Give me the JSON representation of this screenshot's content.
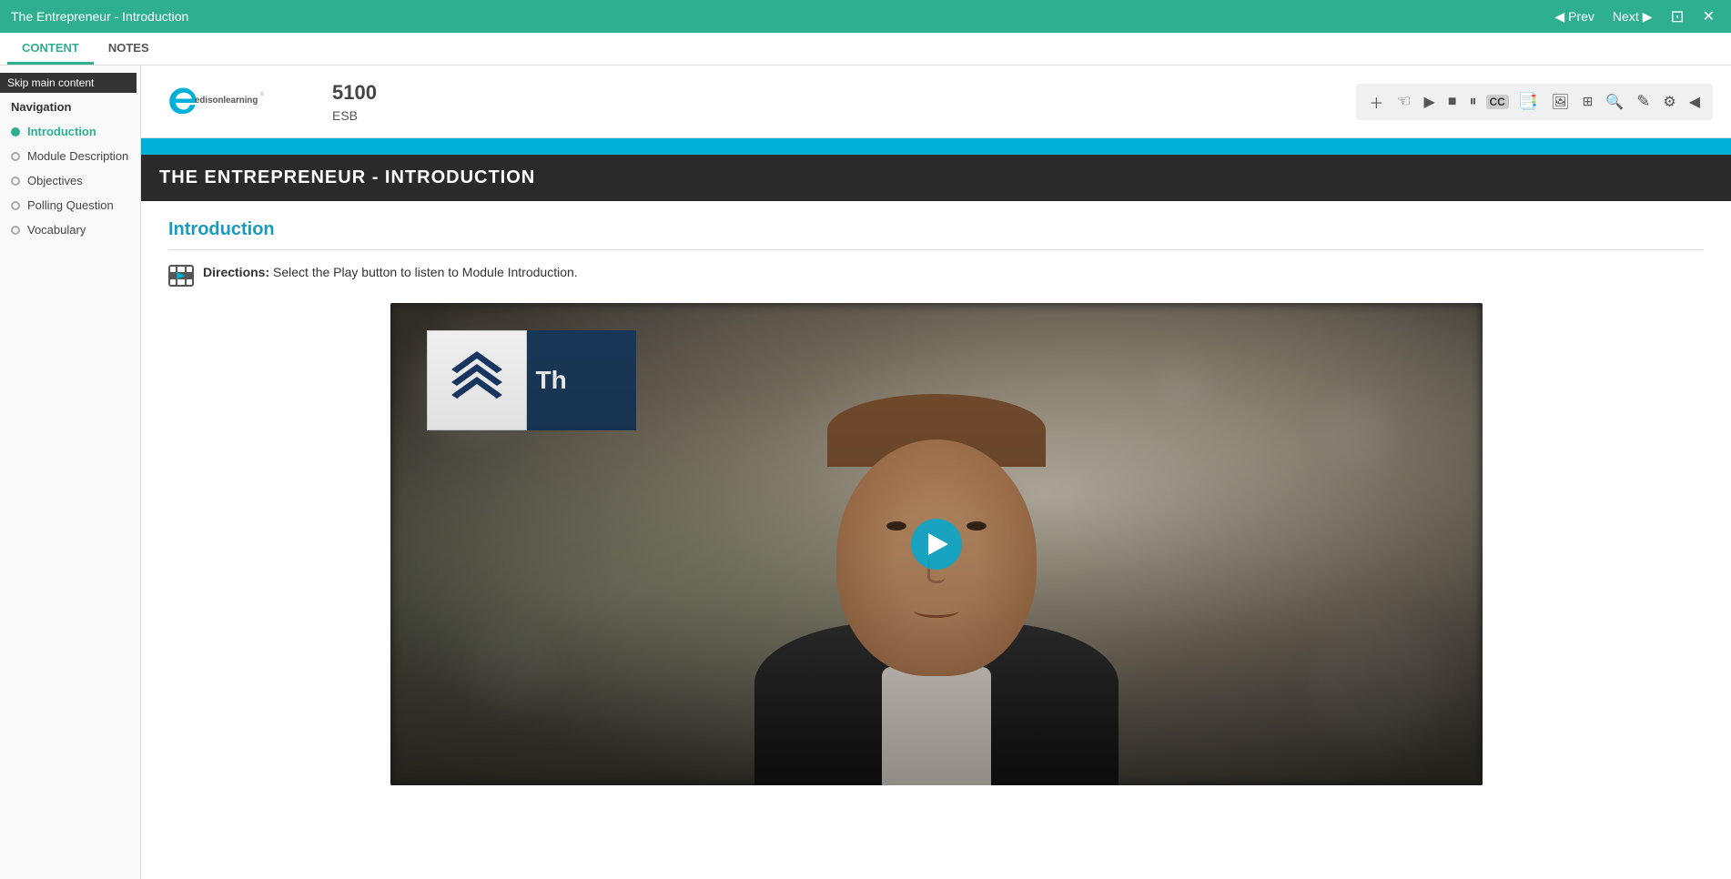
{
  "titlebar": {
    "title": "The Entrepreneur - Introduction",
    "prev_label": "Prev",
    "next_label": "Next",
    "restore_icon": "⊡",
    "close_icon": "✕"
  },
  "tabs": [
    {
      "id": "content",
      "label": "CONTENT",
      "active": true
    },
    {
      "id": "notes",
      "label": "NOTES",
      "active": false
    }
  ],
  "skip_link": "Skip main content",
  "sidebar": {
    "heading": "Navigation",
    "items": [
      {
        "id": "introduction",
        "label": "Introduction",
        "active": true,
        "dot": "active"
      },
      {
        "id": "module-description",
        "label": "Module Description",
        "active": false,
        "dot": "filled"
      },
      {
        "id": "objectives",
        "label": "Objectives",
        "active": false,
        "dot": "filled"
      },
      {
        "id": "polling-question",
        "label": "Polling Question",
        "active": false,
        "dot": "filled"
      },
      {
        "id": "vocabulary",
        "label": "Vocabulary",
        "active": false,
        "dot": "filled"
      }
    ]
  },
  "player": {
    "course_number": "5100",
    "course_sub": "ESB",
    "logo_text": "edisonlearning"
  },
  "toolbar": {
    "buttons": [
      {
        "id": "add",
        "icon": "＋",
        "label": "Add"
      },
      {
        "id": "hand",
        "icon": "☜",
        "label": "Hand"
      },
      {
        "id": "play",
        "icon": "▶",
        "label": "Play"
      },
      {
        "id": "stop",
        "icon": "■",
        "label": "Stop"
      },
      {
        "id": "pause",
        "icon": "⏸",
        "label": "Pause"
      },
      {
        "id": "cc",
        "icon": "CC",
        "label": "Closed Caption"
      },
      {
        "id": "bookmark",
        "icon": "📖",
        "label": "Bookmark"
      },
      {
        "id": "image",
        "icon": "🖼",
        "label": "Image"
      },
      {
        "id": "layout",
        "icon": "⊞",
        "label": "Layout"
      },
      {
        "id": "zoom",
        "icon": "🔍",
        "label": "Zoom"
      },
      {
        "id": "edit",
        "icon": "✎",
        "label": "Edit"
      },
      {
        "id": "settings",
        "icon": "⚙",
        "label": "Settings"
      },
      {
        "id": "collapse",
        "icon": "◀",
        "label": "Collapse"
      }
    ]
  },
  "page_title": "THE ENTREPRENEUR - INTRODUCTION",
  "section": {
    "title": "Introduction",
    "directions_label": "Directions:",
    "directions_text": " Select the Play button to listen to Module Introduction.",
    "intro_card_text": "Th"
  }
}
